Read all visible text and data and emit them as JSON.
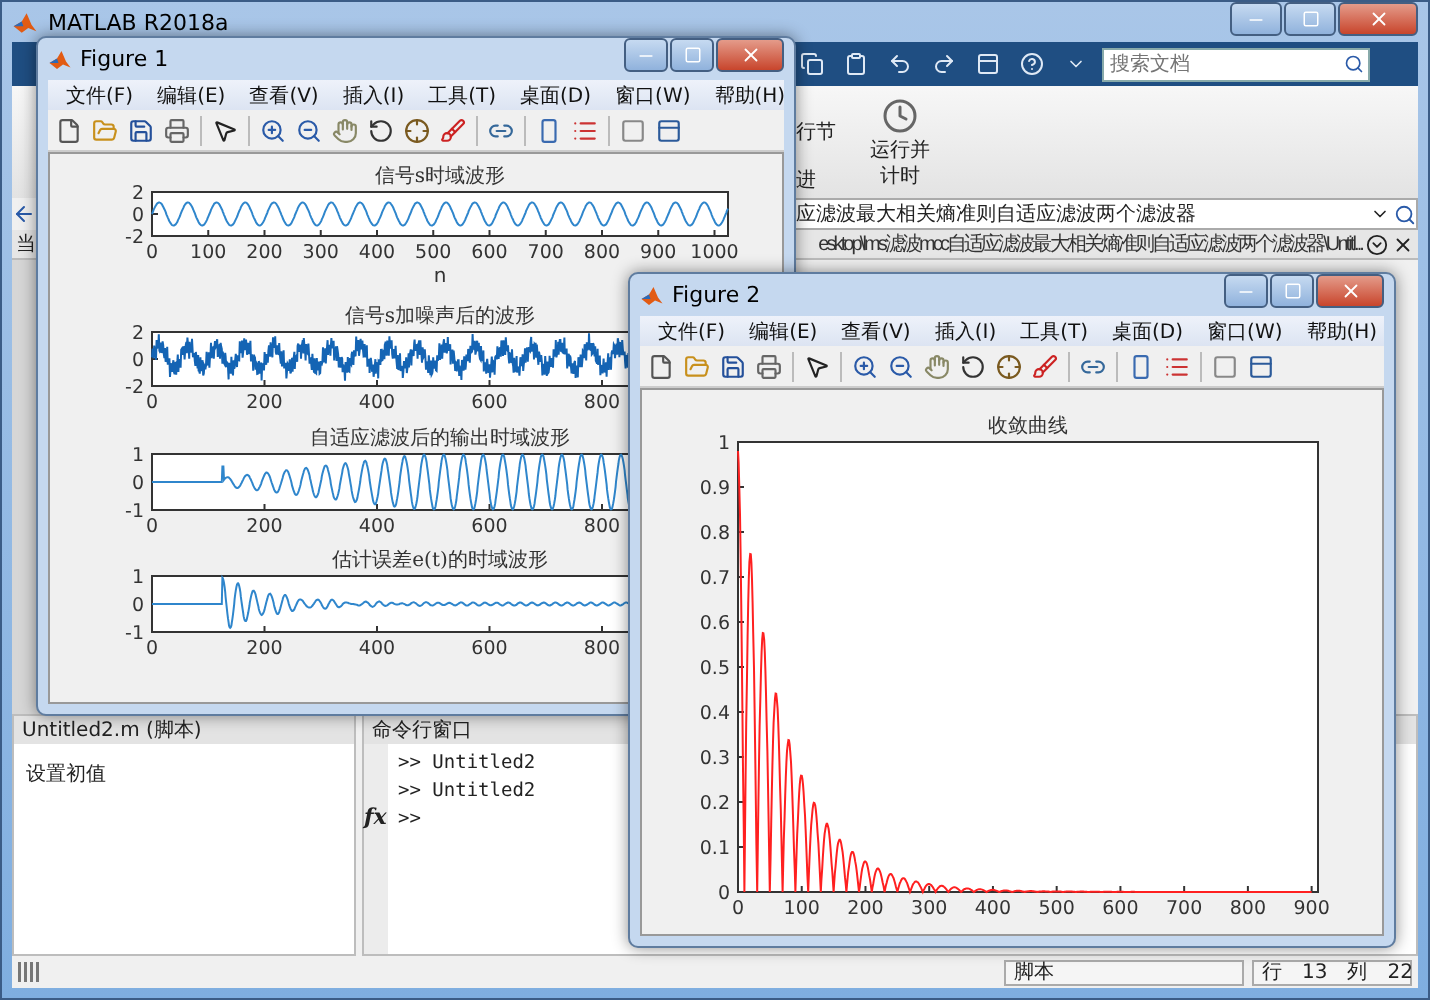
{
  "main_window": {
    "title": "MATLAB R2018a",
    "search": {
      "placeholder": "搜索文档"
    },
    "ribbon": {
      "cut_labels": [
        "行节",
        "进"
      ],
      "run_and_time": "运行并计时"
    },
    "address": "应滤波最大相关熵准则自适应滤波两个滤波器",
    "file_tab": {
      "left_label": "当",
      "path": "esktop\\lms滤波mcc自适应滤波最大相关熵准则自适应滤波两个滤波器\\Untitl..."
    },
    "editor": {
      "header": "Untitled2.m (脚本)",
      "lines": [
        "设置初值"
      ]
    },
    "command_window": {
      "header": "命令行窗口",
      "lines": [
        ">> Untitled2",
        ">> Untitled2"
      ],
      "prompt": ">>",
      "fx": "fx"
    },
    "status_bar": {
      "mode": "脚本",
      "row_label": "行",
      "row": "13",
      "col_label": "列",
      "col": "22"
    }
  },
  "figures": [
    {
      "title": "Figure 1",
      "menus": [
        "文件(F)",
        "编辑(E)",
        "查看(V)",
        "插入(I)",
        "工具(T)",
        "桌面(D)",
        "窗口(W)",
        "帮助(H)"
      ],
      "plots": [
        {
          "kind": "sine",
          "title": "信号s时域波形",
          "xticks": [
            "0",
            "100",
            "200",
            "300",
            "400",
            "500",
            "600",
            "700",
            "800",
            "900",
            "1000"
          ],
          "yticks": [
            "2",
            "0",
            "-2"
          ],
          "xlabel": "n"
        },
        {
          "kind": "noisy",
          "title": "信号s加噪声后的波形",
          "xticks": [
            "0",
            "200",
            "400",
            "600",
            "800"
          ],
          "yticks": [
            "2",
            "0",
            "-2"
          ]
        },
        {
          "kind": "adaptive",
          "title": "自适应滤波后的输出时域波形",
          "xticks": [
            "0",
            "200",
            "400",
            "600",
            "800"
          ],
          "yticks": [
            "1",
            "0",
            "-1"
          ]
        },
        {
          "kind": "error",
          "title": "估计误差e(t)的时域波形",
          "xticks": [
            "0",
            "200",
            "400",
            "600",
            "800"
          ],
          "yticks": [
            "1",
            "0",
            "-1"
          ]
        }
      ]
    },
    {
      "title": "Figure 2",
      "menus": [
        "文件(F)",
        "编辑(E)",
        "查看(V)",
        "插入(I)",
        "工具(T)",
        "桌面(D)",
        "窗口(W)",
        "帮助(H)"
      ],
      "plots": [
        {
          "kind": "convergence",
          "title": "收敛曲线",
          "xticks": [
            "0",
            "100",
            "200",
            "300",
            "400",
            "500",
            "600",
            "700",
            "800",
            "900"
          ],
          "yticks": [
            "1",
            "0.9",
            "0.8",
            "0.7",
            "0.6",
            "0.5",
            "0.4",
            "0.3",
            "0.2",
            "0.1",
            "0"
          ]
        }
      ]
    }
  ]
}
